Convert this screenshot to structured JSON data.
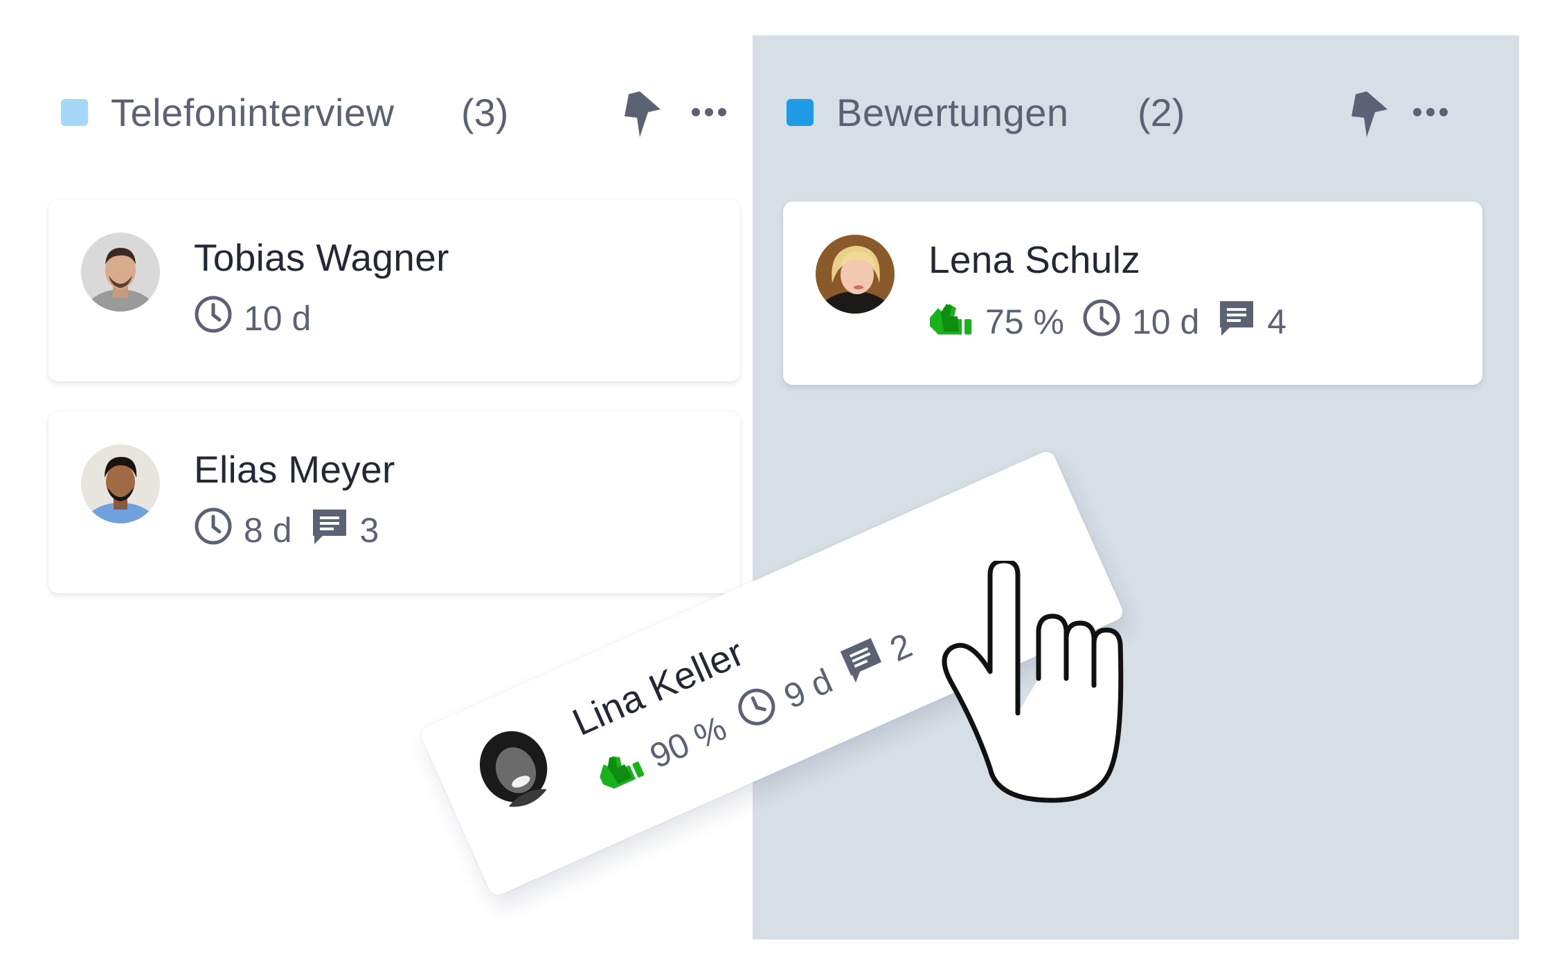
{
  "colors": {
    "column_right_bg": "#d6dee6",
    "telefon_dot": "#a6d8f5",
    "bewertung_dot": "#1f9be6",
    "score_icon": "#19b21b",
    "icon_gray": "#5a6273"
  },
  "columns": [
    {
      "title": "Telefoninterview",
      "count": "(3)",
      "bolt_icon": "lightning-icon",
      "more_icon": "more-dots-icon",
      "cards": [
        {
          "name": "Tobias Wagner",
          "time": "10 d"
        },
        {
          "name": "Elias Meyer",
          "time": "8 d",
          "comments": "3"
        }
      ]
    },
    {
      "title": "Bewertungen",
      "count": "(2)",
      "bolt_icon": "lightning-icon",
      "more_icon": "more-dots-icon",
      "cards": [
        {
          "name": "Lena Schulz",
          "score": "75 %",
          "time": "10 d",
          "comments": "4"
        }
      ]
    }
  ],
  "dragged_card": {
    "name": "Lina Keller",
    "score": "90 %",
    "time": "9 d",
    "comments": "2"
  },
  "cursor": "hand-pointer-icon"
}
